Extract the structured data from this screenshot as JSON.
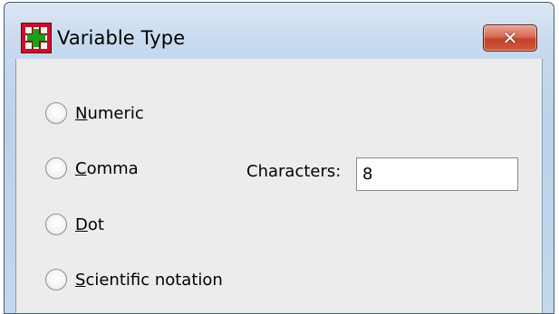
{
  "window": {
    "title": "Variable Type",
    "close_glyph": "✕",
    "app_icon": "spss-data-icon"
  },
  "radios": [
    {
      "label": "Numeric"
    },
    {
      "label": "Comma"
    },
    {
      "label": "Dot"
    },
    {
      "label": "Scientific notation"
    }
  ],
  "characters": {
    "label": "Characters:",
    "value": "8"
  }
}
